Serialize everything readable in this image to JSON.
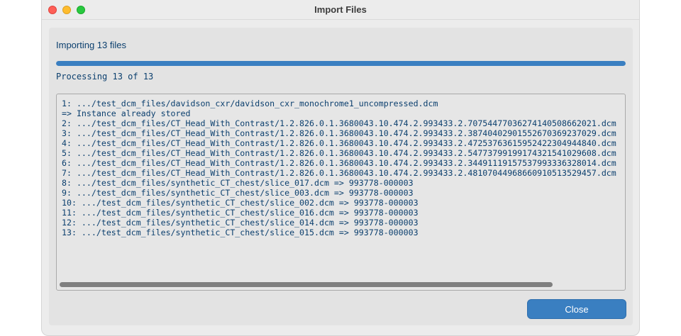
{
  "window": {
    "title": "Import Files"
  },
  "status": {
    "label": "Importing 13 files",
    "progress_fraction": 1.0,
    "processing_label": "Processing 13 of 13"
  },
  "log": {
    "lines": [
      "1: .../test_dcm_files/davidson_cxr/davidson_cxr_monochrome1_uncompressed.dcm",
      "=> Instance already stored",
      "2: .../test_dcm_files/CT_Head_With_Contrast/1.2.826.0.1.3680043.10.474.2.993433.2.7075447703627414050866​2021.dcm",
      "3: .../test_dcm_files/CT_Head_With_Contrast/1.2.826.0.1.3680043.10.474.2.993433.2.38740402901552670369237029.dcm",
      "4: .../test_dcm_files/CT_Head_With_Contrast/1.2.826.0.1.3680043.10.474.2.993433.2.47253763615952422304944840.dcm",
      "5: .../test_dcm_files/CT_Head_With_Contrast/1.2.826.0.1.3680043.10.474.2.993433.2.54773799199174321541029608.dcm",
      "6: .../test_dcm_files/CT_Head_With_Contrast/1.2.826.0.1.3680043.10.474.2.993433.2.34491119157537993336328014.dcm",
      "7: .../test_dcm_files/CT_Head_With_Contrast/1.2.826.0.1.3680043.10.474.2.993433.2.48107044968660910513529457.dcm",
      "8: .../test_dcm_files/synthetic_CT_chest/slice_017.dcm => 993778-000003",
      "9: .../test_dcm_files/synthetic_CT_chest/slice_003.dcm => 993778-000003",
      "10: .../test_dcm_files/synthetic_CT_chest/slice_002.dcm => 993778-000003",
      "11: .../test_dcm_files/synthetic_CT_chest/slice_016.dcm => 993778-000003",
      "12: .../test_dcm_files/synthetic_CT_chest/slice_014.dcm => 993778-000003",
      "13: .../test_dcm_files/synthetic_CT_chest/slice_015.dcm => 993778-000003"
    ]
  },
  "buttons": {
    "close_label": "Close"
  },
  "colors": {
    "accent": "#3a7fc1",
    "text": "#0b3f6e"
  },
  "icons": {
    "close": "close-window-icon",
    "minimize": "minimize-window-icon",
    "zoom": "zoom-window-icon"
  }
}
